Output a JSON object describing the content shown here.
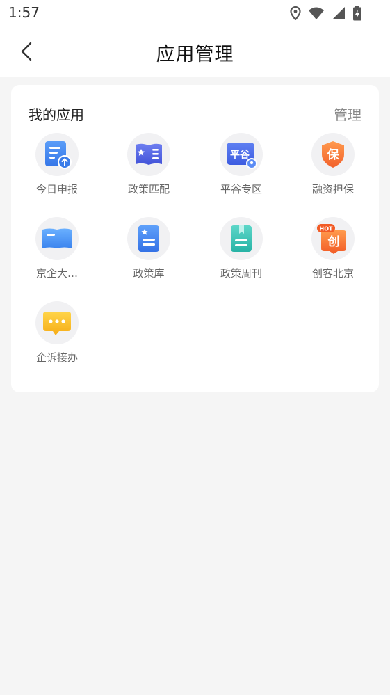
{
  "status": {
    "time": "1:57"
  },
  "nav": {
    "title": "应用管理"
  },
  "card": {
    "title": "我的应用",
    "manage_label": "管理",
    "apps": [
      {
        "label": "今日申报",
        "icon": "doc-upload-icon"
      },
      {
        "label": "政策匹配",
        "icon": "open-book-icon"
      },
      {
        "label": "平谷专区",
        "icon": "pinggu-map-icon",
        "icon_text": "平谷"
      },
      {
        "label": "融资担保",
        "icon": "shield-guarantee-icon",
        "icon_text": "保"
      },
      {
        "label": "京企大…",
        "icon": "blue-book-icon"
      },
      {
        "label": "政策库",
        "icon": "star-document-icon"
      },
      {
        "label": "政策周刊",
        "icon": "bookmark-document-icon"
      },
      {
        "label": "创客北京",
        "icon": "hot-create-icon",
        "icon_text": "创",
        "badge": "HOT"
      },
      {
        "label": "企诉接办",
        "icon": "chat-bubble-icon"
      }
    ]
  }
}
